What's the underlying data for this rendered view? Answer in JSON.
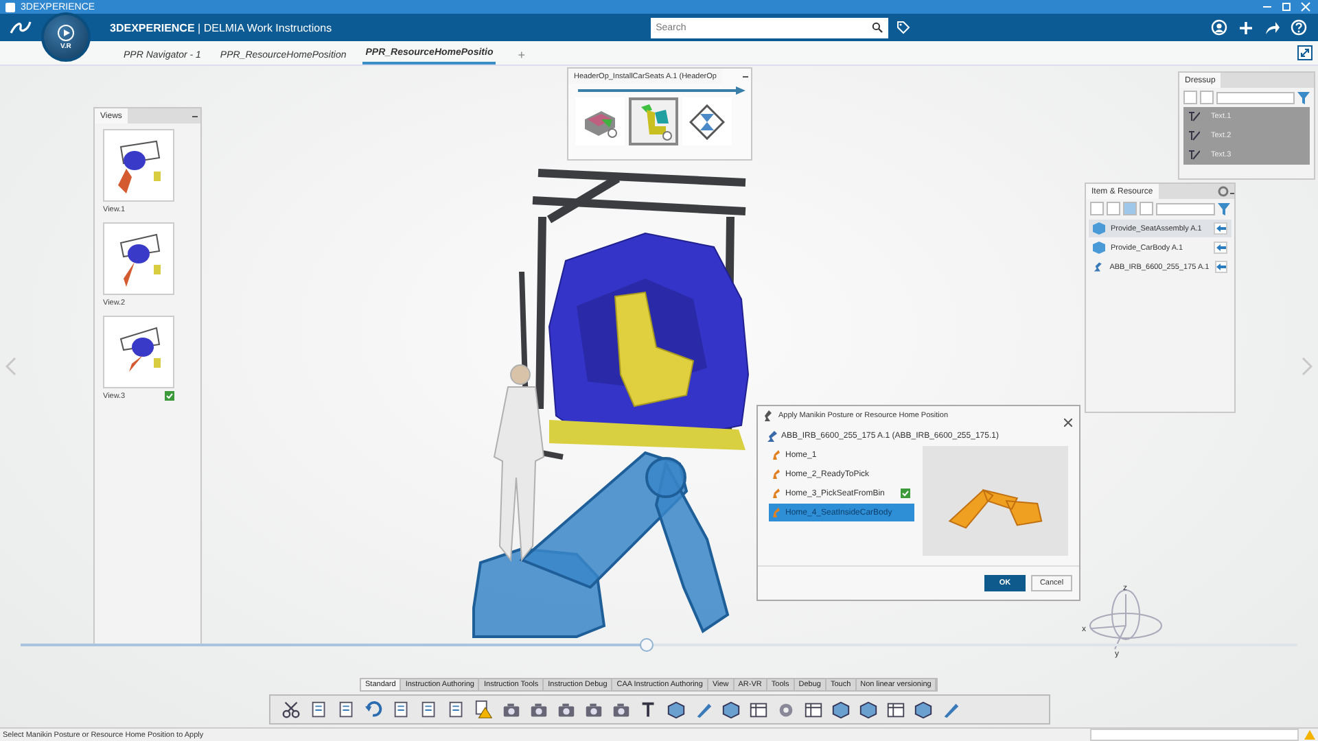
{
  "window": {
    "title": "3DEXPERIENCE"
  },
  "app_bar": {
    "brand": "3DEXPERIENCE",
    "product": "| DELMIA",
    "app": "Work Instructions",
    "compass_label": "V.R",
    "search": {
      "placeholder": "Search"
    }
  },
  "tabs": [
    {
      "label": "PPR Navigator - 1",
      "selected": false
    },
    {
      "label": "PPR_ResourceHomePosition",
      "selected": false
    },
    {
      "label": "PPR_ResourceHomePositio",
      "selected": true
    }
  ],
  "add_tab": "+",
  "views_panel": {
    "title": "Views",
    "items": [
      {
        "label": "View.1",
        "checked": false
      },
      {
        "label": "View.2",
        "checked": false
      },
      {
        "label": "View.3",
        "checked": true
      }
    ]
  },
  "operation_panel": {
    "title": "HeaderOp_InstallCarSeats A.1 (HeaderOp",
    "steps": [
      {
        "kind": "part",
        "selected": false
      },
      {
        "kind": "seat",
        "selected": true
      },
      {
        "kind": "wait",
        "selected": false
      }
    ]
  },
  "dressup_panel": {
    "title": "Dressup",
    "items": [
      {
        "label": "Text.1"
      },
      {
        "label": "Text.2"
      },
      {
        "label": "Text.3"
      }
    ]
  },
  "item_resource_panel": {
    "title": "Item & Resource",
    "items": [
      {
        "label": "Provide_SeatAssembly A.1",
        "kind": "item",
        "selected": true
      },
      {
        "label": "Provide_CarBody A.1",
        "kind": "item",
        "selected": false
      },
      {
        "label": "ABB_IRB_6600_255_175 A.1",
        "kind": "resource",
        "selected": false
      }
    ]
  },
  "dialog": {
    "title": "Apply Manikin Posture or Resource Home Position",
    "resource": "ABB_IRB_6600_255_175 A.1 (ABB_IRB_6600_255_175.1)",
    "positions": [
      {
        "label": "Home_1",
        "selected": false,
        "checked": false
      },
      {
        "label": "Home_2_ReadyToPick",
        "selected": false,
        "checked": false
      },
      {
        "label": "Home_3_PickSeatFromBin",
        "selected": false,
        "checked": true
      },
      {
        "label": "Home_4_SeatInsideCarBody",
        "selected": true,
        "checked": false
      }
    ],
    "buttons": [
      {
        "label": "OK",
        "kind": "primary"
      },
      {
        "label": "Cancel",
        "kind": "secondary"
      }
    ]
  },
  "video": {
    "level": 0.49
  },
  "compass": {
    "axes": [
      "x",
      "y",
      "z"
    ]
  },
  "toolbar_tabs": [
    {
      "label": "Standard",
      "selected": true
    },
    {
      "label": "Instruction Authoring",
      "selected": false
    },
    {
      "label": "Instruction Tools",
      "selected": false
    },
    {
      "label": "Instruction Debug",
      "selected": false
    },
    {
      "label": "CAA Instruction Authoring",
      "selected": false
    },
    {
      "label": "View",
      "selected": false
    },
    {
      "label": "AR-VR",
      "selected": false
    },
    {
      "label": "Tools",
      "selected": false
    },
    {
      "label": "Debug",
      "selected": false
    },
    {
      "label": "Touch",
      "selected": false
    },
    {
      "label": "Non linear versioning",
      "selected": false
    }
  ],
  "status_bar": {
    "message": "Select Manikin Posture or Resource Home Position to Apply"
  }
}
